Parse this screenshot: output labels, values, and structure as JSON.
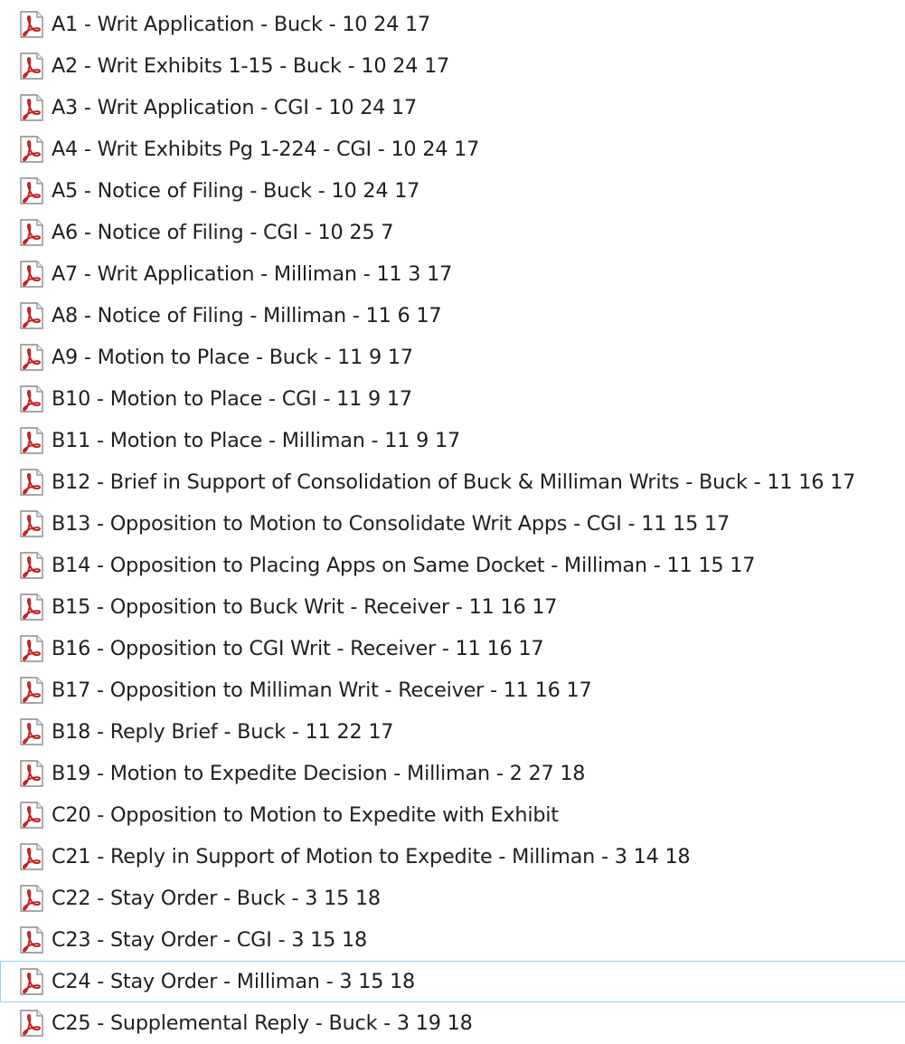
{
  "file_icon": "pdf-file-icon",
  "colors": {
    "icon_red": "#c3201f",
    "focus_border": "#99d1ff",
    "text": "#1f1f1f"
  },
  "files": [
    {
      "name": "A1 - Writ Application - Buck - 10 24 17"
    },
    {
      "name": "A2 - Writ Exhibits 1-15 - Buck - 10 24 17"
    },
    {
      "name": "A3 - Writ Application - CGI - 10 24 17"
    },
    {
      "name": "A4 - Writ Exhibits Pg 1-224 - CGI - 10 24 17"
    },
    {
      "name": "A5 - Notice of Filing - Buck - 10 24 17"
    },
    {
      "name": "A6 - Notice of Filing - CGI - 10 25 7"
    },
    {
      "name": "A7 - Writ Application - Milliman - 11 3 17"
    },
    {
      "name": "A8 - Notice of Filing - Milliman - 11 6 17"
    },
    {
      "name": "A9 - Motion to Place - Buck - 11 9 17"
    },
    {
      "name": "B10 - Motion to Place - CGI - 11 9 17"
    },
    {
      "name": "B11 - Motion to Place - Milliman - 11 9 17"
    },
    {
      "name": "B12 - Brief in Support of Consolidation of Buck & Milliman Writs - Buck - 11 16 17"
    },
    {
      "name": "B13 - Opposition to Motion to Consolidate Writ Apps - CGI - 11 15 17"
    },
    {
      "name": "B14 - Opposition to Placing Apps on Same Docket - Milliman - 11 15 17"
    },
    {
      "name": "B15 - Opposition to Buck Writ - Receiver - 11 16 17"
    },
    {
      "name": "B16 - Opposition to CGI Writ - Receiver - 11 16 17"
    },
    {
      "name": "B17 - Opposition to Milliman Writ - Receiver - 11 16 17"
    },
    {
      "name": "B18 - Reply Brief - Buck - 11 22 17"
    },
    {
      "name": "B19 - Motion to Expedite Decision - Milliman - 2 27 18"
    },
    {
      "name": "C20 - Opposition to Motion to Expedite with Exhibit"
    },
    {
      "name": "C21 - Reply in Support of Motion to Expedite - Milliman - 3 14 18"
    },
    {
      "name": "C22 - Stay Order - Buck - 3 15 18"
    },
    {
      "name": "C23 - Stay Order - CGI - 3 15 18"
    },
    {
      "name": "C24 - Stay Order - Milliman - 3 15 18",
      "focused": true
    },
    {
      "name": "C25 - Supplemental Reply - Buck - 3 19 18"
    }
  ]
}
